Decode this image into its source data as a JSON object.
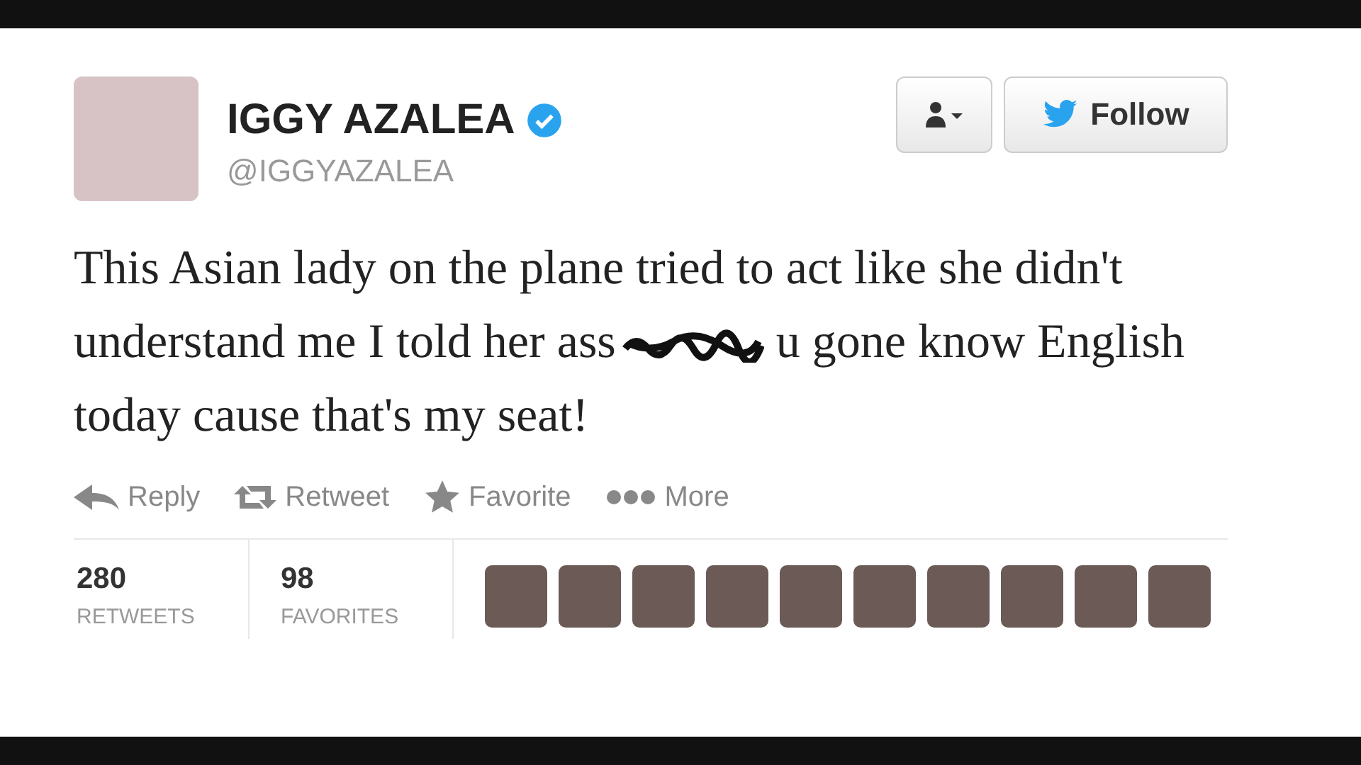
{
  "author": {
    "name": "IGGY AZALEA",
    "verified": true,
    "handle": "@IGGYAZALEA"
  },
  "buttons": {
    "follow": "Follow"
  },
  "tweet": [
    {
      "kind": "text",
      "text": "This Asian lady on the plane tried to act like she didn't understand me I told her ass"
    },
    {
      "kind": "scribble"
    },
    {
      "kind": "text",
      "text": "u gone know English today cause that's my seat!"
    }
  ],
  "actions": [
    {
      "kind": "reply",
      "label": "Reply"
    },
    {
      "kind": "retweet",
      "label": "Retweet"
    },
    {
      "kind": "favorite",
      "label": "Favorite"
    },
    {
      "kind": "more",
      "label": "More"
    }
  ],
  "stats": [
    {
      "count": "280",
      "label": "RETWEETS"
    },
    {
      "count": "98",
      "label": "FAVORITES"
    }
  ],
  "favoriters": [
    {
      "kind": "photo"
    },
    {
      "kind": "photo"
    },
    {
      "kind": "photo"
    },
    {
      "kind": "photo"
    },
    {
      "kind": "photo"
    },
    {
      "kind": "photo"
    },
    {
      "kind": "photo"
    },
    {
      "kind": "photo"
    },
    {
      "kind": "photo"
    },
    {
      "kind": "photo"
    }
  ]
}
